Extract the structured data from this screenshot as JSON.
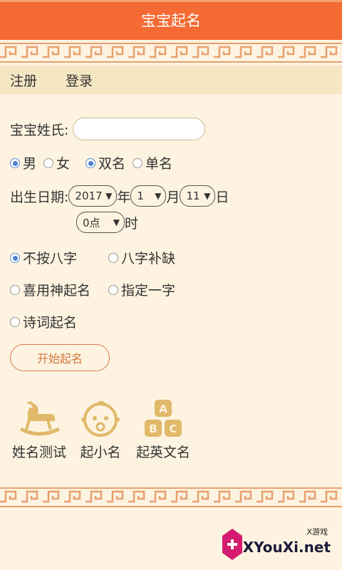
{
  "app": {
    "title": "宝宝起名"
  },
  "auth": {
    "register": "注册",
    "login": "登录"
  },
  "form": {
    "surname_label": "宝宝姓氏:",
    "surname_value": "",
    "gender": [
      {
        "label": "男",
        "selected": true
      },
      {
        "label": "女",
        "selected": false
      }
    ],
    "name_length": [
      {
        "label": "双名",
        "selected": true
      },
      {
        "label": "单名",
        "selected": false
      }
    ],
    "birth_label": "出生日期:",
    "year": "2017",
    "year_unit": "年",
    "month": "1",
    "month_unit": "月",
    "day": "11",
    "day_unit": "日",
    "hour": "0点",
    "hour_unit": "时",
    "modes": [
      {
        "label": "不按八字",
        "selected": true
      },
      {
        "label": "八字补缺",
        "selected": false
      },
      {
        "label": "喜用神起名",
        "selected": false
      },
      {
        "label": "指定一字",
        "selected": false
      },
      {
        "label": "诗词起名",
        "selected": false
      }
    ],
    "start_label": "开始起名"
  },
  "tiles": [
    {
      "label": "姓名测试",
      "icon": "rocking-horse-icon"
    },
    {
      "label": "起小名",
      "icon": "baby-face-icon"
    },
    {
      "label": "起英文名",
      "icon": "abc-blocks-icon"
    }
  ],
  "watermark": {
    "site": "XYouXi.net",
    "small": "X游戏"
  },
  "colors": {
    "header": "#f46a32",
    "background": "#fdf3e0",
    "accent": "#d2793f",
    "icon": "#e0b96a",
    "radio": "#4d7fd0"
  }
}
